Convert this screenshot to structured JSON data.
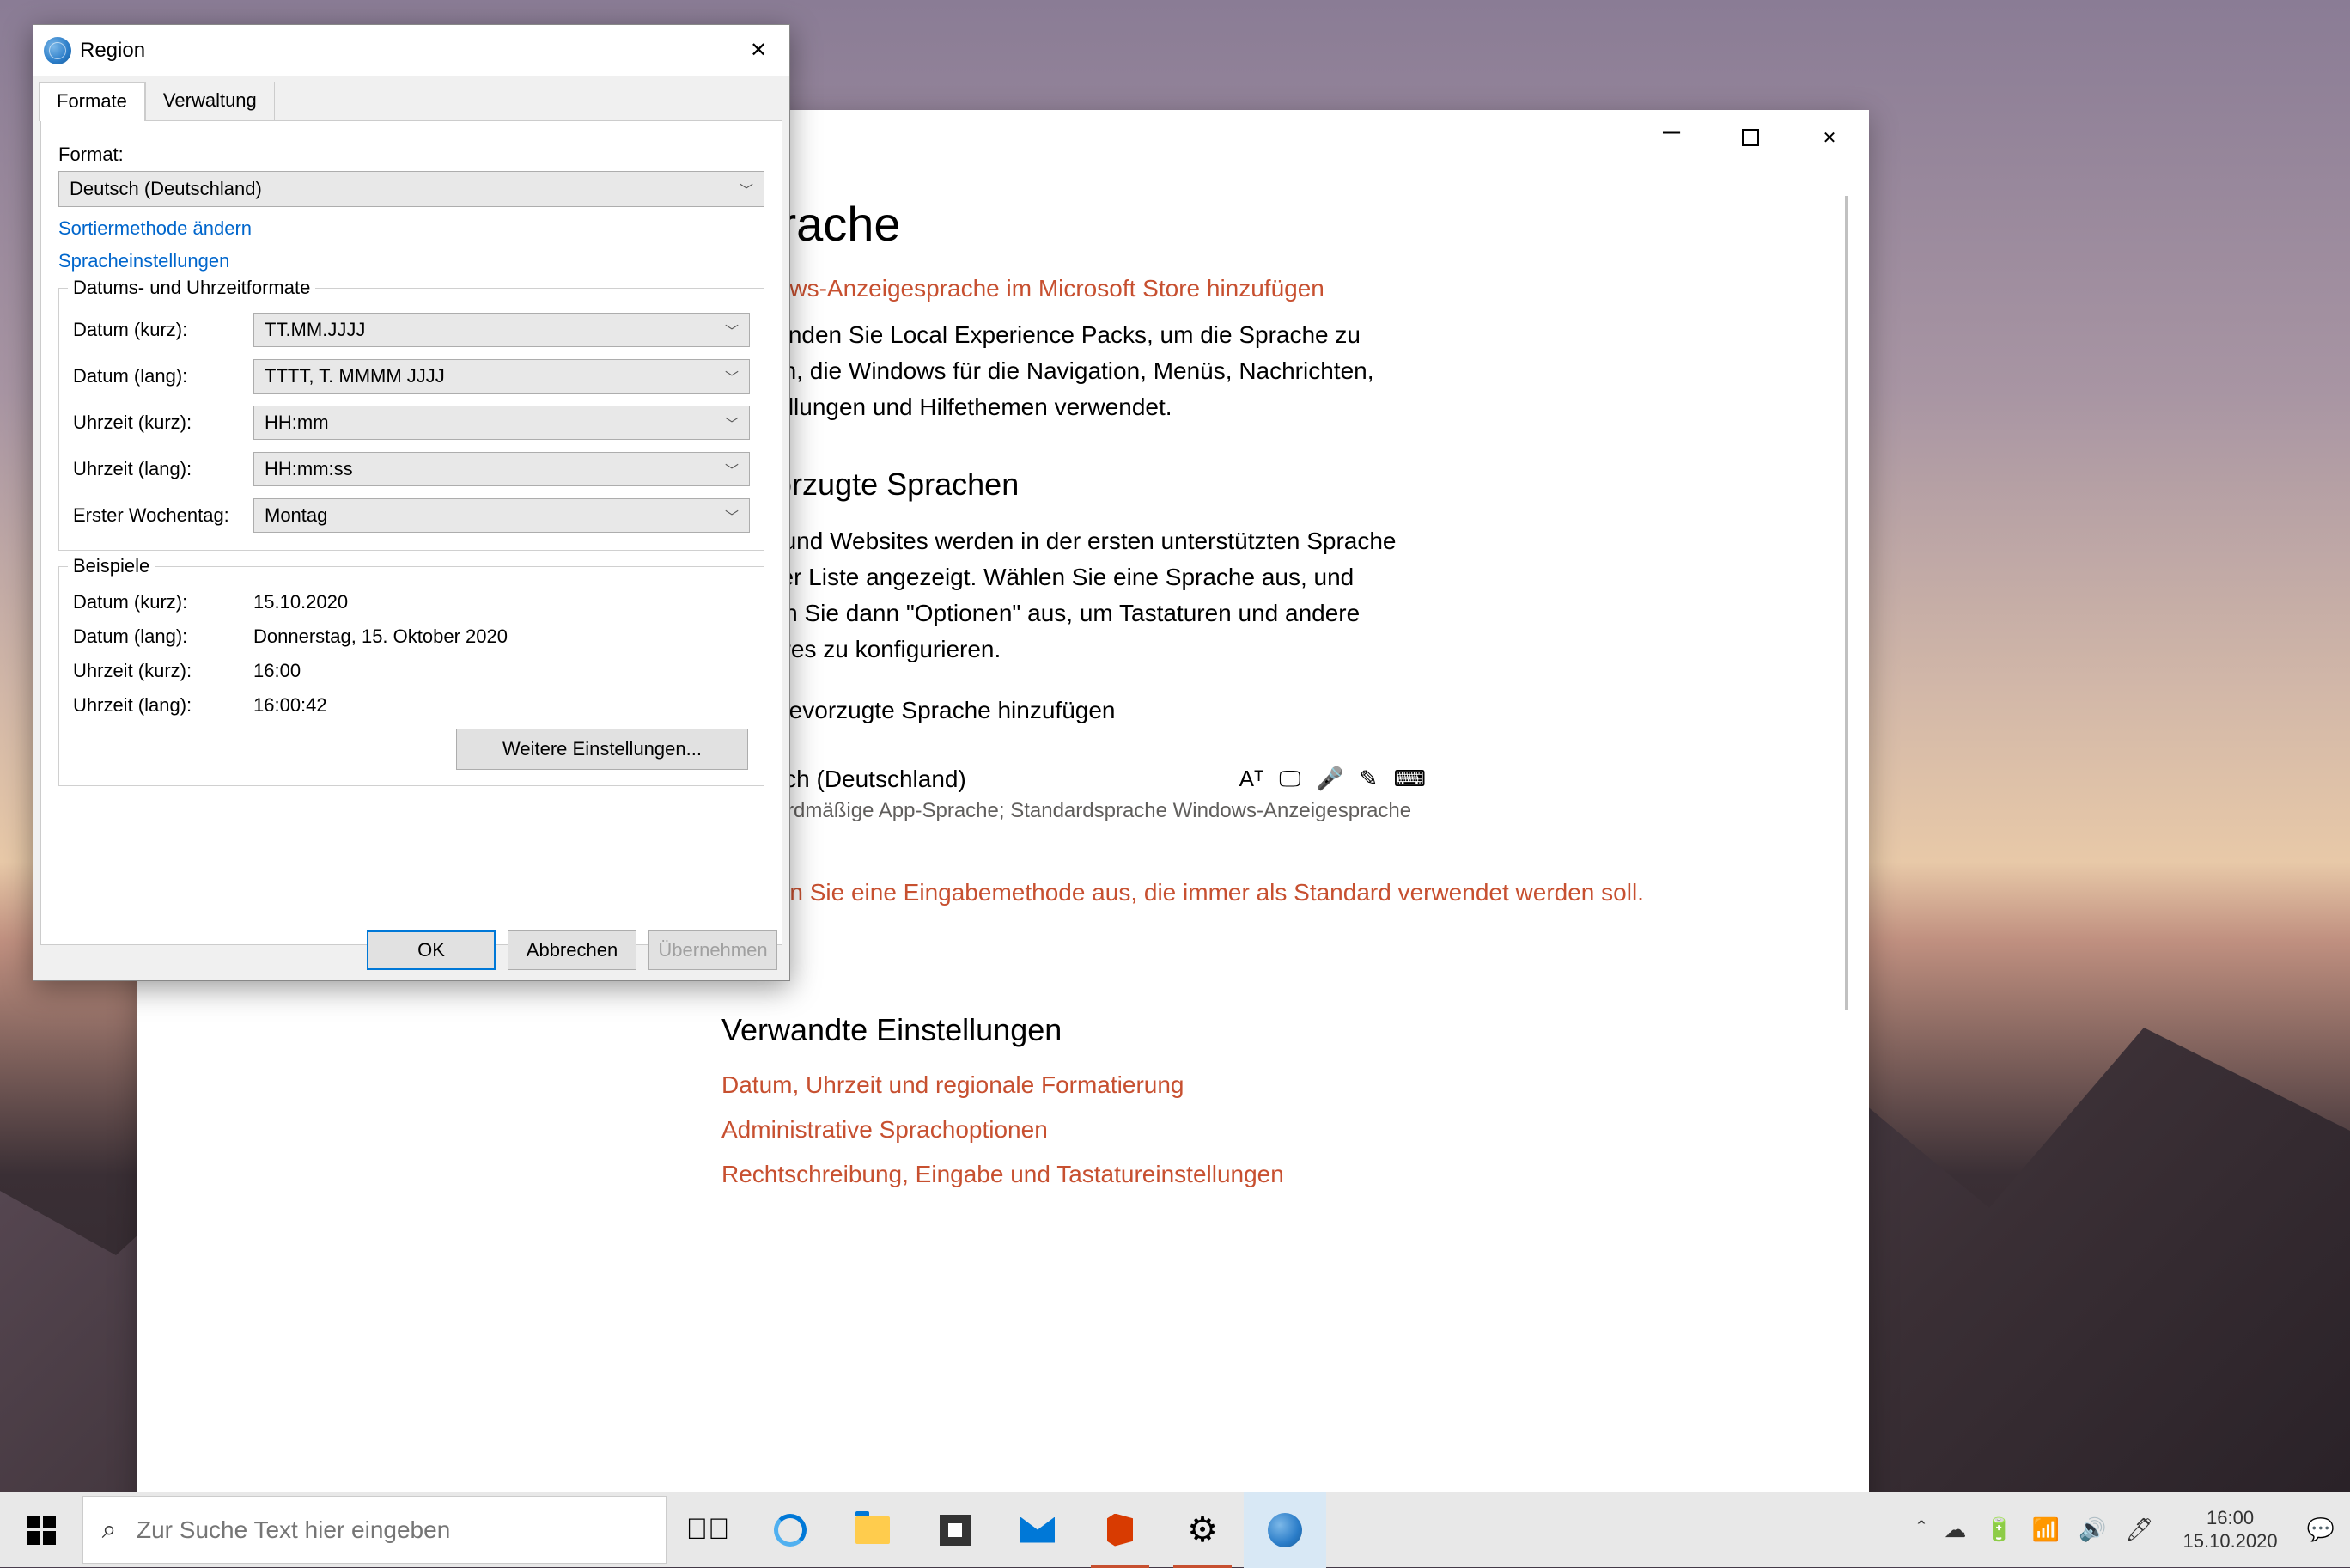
{
  "settings": {
    "title": "Sprache",
    "partial1": "Windows-Anzeigesprache im Microsoft Store hinzufügen",
    "partial2": "Verwenden Sie Local Experience Packs, um die Sprache zu ändern, die Windows für die Navigation, Menüs, Nachrichten, Einstellungen und Hilfethemen verwendet.",
    "h2_pref": "Bevorzugte Sprachen",
    "pref_text": "Apps und Websites werden in der ersten unterstützten Sprache aus der Liste angezeigt. Wählen Sie eine Sprache aus, und wählen Sie dann \"Optionen\" aus, um Tastaturen und andere Features zu konfigurieren.",
    "add_lang": "Bevorzugte Sprache hinzufügen",
    "lang_name": "Deutsch (Deutschland)",
    "lang_sub": "Standardmäßige App-Sprache; Standardsprache Windows-Anzeigesprache",
    "input_link": "Wählen Sie eine Eingabemethode aus, die immer als Standard verwendet werden soll.",
    "h2_related": "Verwandte Einstellungen",
    "rel1": "Datum, Uhrzeit und regionale Formatierung",
    "rel2": "Administrative Sprachoptionen",
    "rel3": "Rechtschreibung, Eingabe und Tastatureinstellungen",
    "win_min": "—",
    "win_max": "▢",
    "win_close": "✕"
  },
  "region": {
    "title": "Region",
    "tab_formats": "Formate",
    "tab_admin": "Verwaltung",
    "format_label": "Format:",
    "format_value": "Deutsch (Deutschland)",
    "link_sort": "Sortiermethode ändern",
    "link_lang": "Spracheinstellungen",
    "group_dt": "Datums- und Uhrzeitformate",
    "lbl_date_short": "Datum (kurz):",
    "val_date_short": "TT.MM.JJJJ",
    "lbl_date_long": "Datum (lang):",
    "val_date_long": "TTTT, T. MMMM JJJJ",
    "lbl_time_short": "Uhrzeit (kurz):",
    "val_time_short": "HH:mm",
    "lbl_time_long": "Uhrzeit (lang):",
    "val_time_long": "HH:mm:ss",
    "lbl_firstday": "Erster Wochentag:",
    "val_firstday": "Montag",
    "group_ex": "Beispiele",
    "ex_date_short": "15.10.2020",
    "ex_date_long": "Donnerstag, 15. Oktober 2020",
    "ex_time_short": "16:00",
    "ex_time_long": "16:00:42",
    "more": "Weitere Einstellungen...",
    "ok": "OK",
    "cancel": "Abbrechen",
    "apply": "Übernehmen"
  },
  "taskbar": {
    "search_placeholder": "Zur Suche Text hier eingeben",
    "time": "16:00",
    "date": "15.10.2020"
  }
}
